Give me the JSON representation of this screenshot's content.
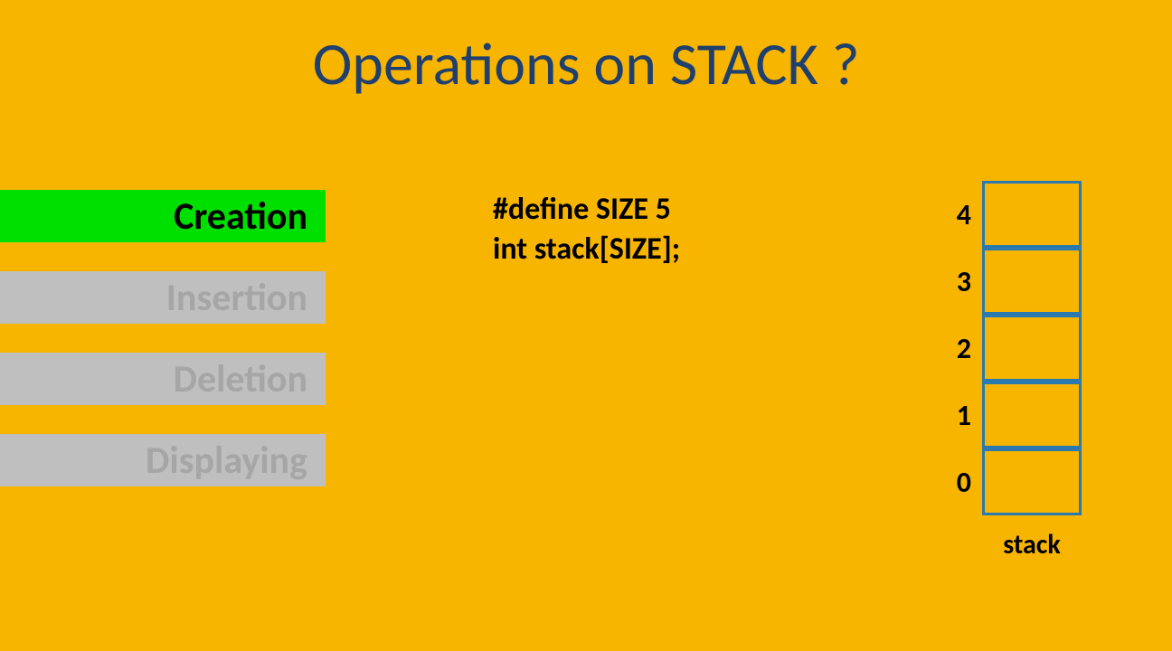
{
  "title": "Operations on STACK ?",
  "operations": [
    {
      "label": "Creation",
      "active": true
    },
    {
      "label": "Insertion",
      "active": false
    },
    {
      "label": "Deletion",
      "active": false
    },
    {
      "label": "Displaying",
      "active": false
    }
  ],
  "code": {
    "line1": "#define   SIZE  5",
    "line2": "int stack[SIZE];"
  },
  "stack": {
    "indices": [
      "4",
      "3",
      "2",
      "1",
      "0"
    ],
    "label": "stack"
  }
}
